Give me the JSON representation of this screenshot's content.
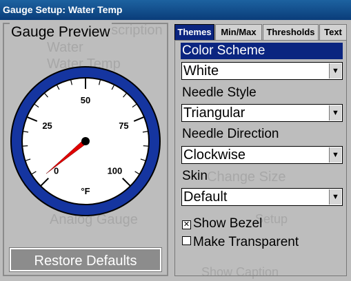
{
  "window": {
    "title": "Gauge Setup: Water Temp"
  },
  "preview": {
    "label": "Gauge Preview",
    "ticks": [
      "0",
      "25",
      "50",
      "75",
      "100"
    ],
    "unit": "°F",
    "needle_value": 0.02
  },
  "restore_button": "Restore Defaults",
  "tabs": [
    {
      "label": "Themes",
      "active": true
    },
    {
      "label": "Min/Max",
      "active": false
    },
    {
      "label": "Thresholds",
      "active": false
    },
    {
      "label": "Text",
      "active": false
    }
  ],
  "themes": {
    "color_scheme_label": "Color Scheme",
    "color_scheme_value": "White",
    "needle_style_label": "Needle Style",
    "needle_style_value": "Triangular",
    "needle_direction_label": "Needle Direction",
    "needle_direction_value": "Clockwise",
    "skin_label": "Skin",
    "skin_value": "Default",
    "show_bezel_label": "Show Bezel",
    "show_bezel_checked": true,
    "make_transparent_label": "Make Transparent",
    "make_transparent_checked": false
  },
  "background_ghost": {
    "gauge_description": "Gauge Description",
    "water": "Water",
    "water_temp": "Water Temp",
    "analog_gauge": "Analog Gauge",
    "change_size": "Change Size",
    "show_caption": "Show Caption",
    "setup": "Setup"
  },
  "colors": {
    "selected": "#0b2580",
    "bezel": "#1535a0",
    "needle": "#e00000"
  }
}
